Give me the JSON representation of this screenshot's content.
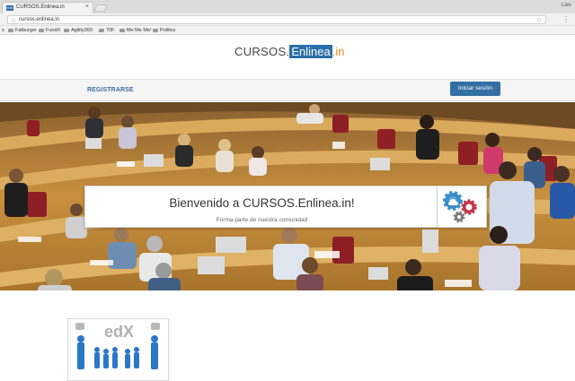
{
  "browser": {
    "tab_title": "CURSOS.Enlinea.in",
    "tab_favicon": "edX",
    "profile_name": "Liev",
    "url": "cursos.enlinea.in",
    "bookmarks_partial": "s",
    "bookmarks": [
      "Fatburger",
      "FundX",
      "Agility360",
      "70F",
      "Me Me Me!",
      "Politics"
    ]
  },
  "site": {
    "logo": {
      "part1": "CURSOS.",
      "part2": "Enlinea",
      "part3": ".in"
    },
    "nav": {
      "register_label": "REGISTRARSE",
      "login_label": "Iniciar sesión"
    },
    "hero": {
      "title": "Bienvenido a CURSOS.Enlinea.in!",
      "subtitle": "Forma parte de nuestra comunidad"
    },
    "course_card": {
      "logo_text": "edX"
    }
  },
  "colors": {
    "brand_blue": "#2a6fa8",
    "brand_orange": "#e8891e",
    "button_blue": "#336fa3"
  }
}
